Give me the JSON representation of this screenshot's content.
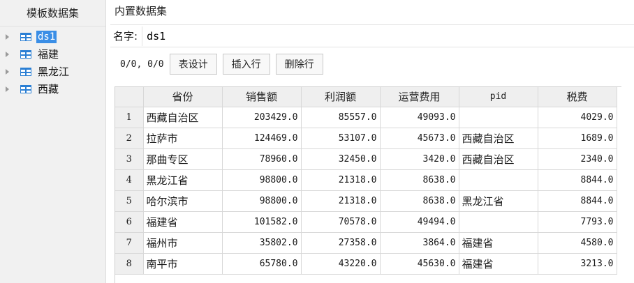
{
  "left": {
    "title": "模板数据集",
    "items": [
      {
        "label": "ds1",
        "selected": true
      },
      {
        "label": "福建",
        "selected": false
      },
      {
        "label": "黑龙江",
        "selected": false
      },
      {
        "label": "西藏",
        "selected": false
      }
    ]
  },
  "right": {
    "title": "内置数据集",
    "name_label": "名字:",
    "name_value": "ds1",
    "counter": "0/0, 0/0",
    "buttons": {
      "table_design": "表设计",
      "insert_row": "插入行",
      "delete_row": "删除行"
    }
  },
  "table": {
    "columns": [
      "省份",
      "销售额",
      "利润额",
      "运营费用",
      "pid",
      "税费"
    ],
    "rows": [
      {
        "n": "1",
        "cells": [
          "西藏自治区",
          "203429.0",
          "85557.0",
          "49093.0",
          "",
          "4029.0"
        ]
      },
      {
        "n": "2",
        "cells": [
          "拉萨市",
          "124469.0",
          "53107.0",
          "45673.0",
          "西藏自治区",
          "1689.0"
        ]
      },
      {
        "n": "3",
        "cells": [
          "那曲专区",
          "78960.0",
          "32450.0",
          "3420.0",
          "西藏自治区",
          "2340.0"
        ]
      },
      {
        "n": "4",
        "cells": [
          "黑龙江省",
          "98800.0",
          "21318.0",
          "8638.0",
          "",
          "8844.0"
        ]
      },
      {
        "n": "5",
        "cells": [
          "哈尔滨市",
          "98800.0",
          "21318.0",
          "8638.0",
          "黑龙江省",
          "8844.0"
        ]
      },
      {
        "n": "6",
        "cells": [
          "福建省",
          "101582.0",
          "70578.0",
          "49494.0",
          "",
          "7793.0"
        ]
      },
      {
        "n": "7",
        "cells": [
          "福州市",
          "35802.0",
          "27358.0",
          "3864.0",
          "福建省",
          "4580.0"
        ]
      },
      {
        "n": "8",
        "cells": [
          "南平市",
          "65780.0",
          "43220.0",
          "45630.0",
          "福建省",
          "3213.0"
        ]
      }
    ]
  },
  "colors": {
    "selection": "#3a8ee6",
    "icon": "#2b7fd4"
  },
  "icons": {
    "tree_arrow": "triangle-right-icon",
    "dataset": "dataset-table-icon"
  }
}
